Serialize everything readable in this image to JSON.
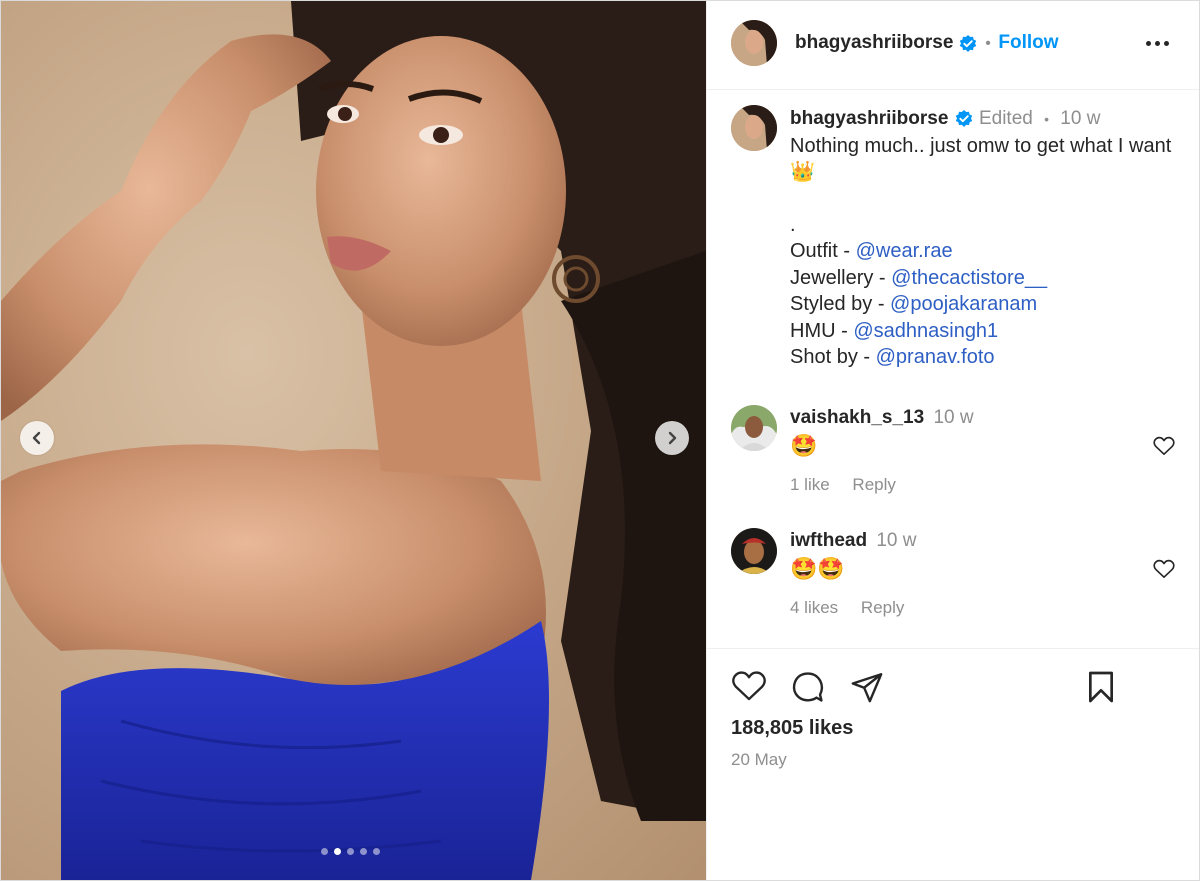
{
  "post": {
    "username": "bhagyashriiborse",
    "follow_label": "Follow",
    "separator": "•",
    "image_count": 5,
    "active_image_index": 1
  },
  "caption": {
    "username": "bhagyashriiborse",
    "edited_label": "Edited",
    "dot": "•",
    "time": "10 w",
    "text_line": "Nothing much.. just omw to get what I want",
    "crown_emoji": "👑",
    "period": ".",
    "credits": [
      {
        "label": "Outfit - ",
        "handle": "@wear.rae"
      },
      {
        "label": "Jewellery - ",
        "handle": "@thecactistore__"
      },
      {
        "label": "Styled by - ",
        "handle": "@poojakaranam"
      },
      {
        "label": "HMU - ",
        "handle": "@sadhnasingh1"
      },
      {
        "label": "Shot by - ",
        "handle": "@pranav.foto"
      }
    ]
  },
  "comments": [
    {
      "username": "vaishakh_s_13",
      "time": "10 w",
      "emoji": "🤩",
      "likes": "1 like",
      "reply": "Reply"
    },
    {
      "username": "iwfthead",
      "time": "10 w",
      "emoji": "🤩🤩",
      "likes": "4 likes",
      "reply": "Reply"
    }
  ],
  "footer": {
    "likes": "188,805 likes",
    "date": "20 May"
  },
  "icons": [
    "chevron-left-icon",
    "chevron-right-icon",
    "verified-badge-icon",
    "more-icon",
    "heart-icon",
    "comment-icon",
    "share-icon",
    "bookmark-icon"
  ],
  "colors": {
    "link": "#0095f6",
    "mention": "#2e5fc4",
    "verified": "#0095f6",
    "muted": "#8e8e8e",
    "dress": "#2431b8"
  }
}
